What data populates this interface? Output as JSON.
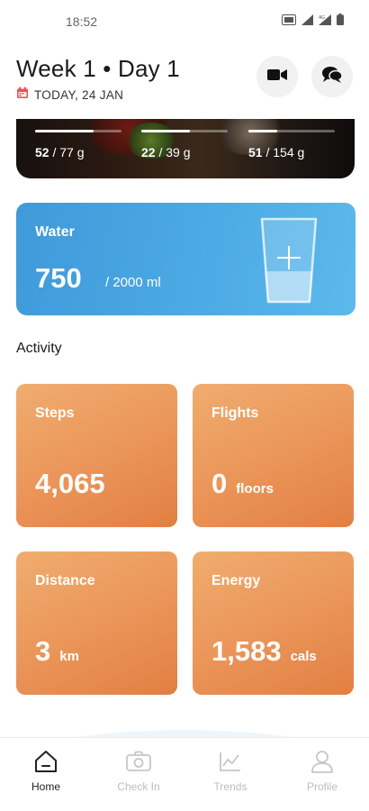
{
  "status_bar": {
    "time": "18:52"
  },
  "header": {
    "title": "Week 1 • Day 1",
    "date": "TODAY, 24 JAN"
  },
  "macros": [
    {
      "current": "52",
      "goal": "/ 77 g",
      "fraction": 0.68
    },
    {
      "current": "22",
      "goal": "/ 39 g",
      "fraction": 0.56
    },
    {
      "current": "51",
      "goal": "/ 154 g",
      "fraction": 0.33
    }
  ],
  "water": {
    "label": "Water",
    "value": "750",
    "goal": "/ 2000 ml",
    "fraction": 0.375
  },
  "activity": {
    "title": "Activity",
    "steps": {
      "label": "Steps",
      "value": "4,065",
      "unit": ""
    },
    "flights": {
      "label": "Flights",
      "value": "0",
      "unit": "floors"
    },
    "distance": {
      "label": "Distance",
      "value": "3",
      "unit": "km"
    },
    "energy": {
      "label": "Energy",
      "value": "1,583",
      "unit": "cals"
    }
  },
  "nav": {
    "home": "Home",
    "checkin": "Check In",
    "trends": "Trends",
    "profile": "Profile"
  },
  "colors": {
    "water_card": "#4aa8e3",
    "activity_card": "#ea9458",
    "calendar_icon": "#e8505b"
  }
}
